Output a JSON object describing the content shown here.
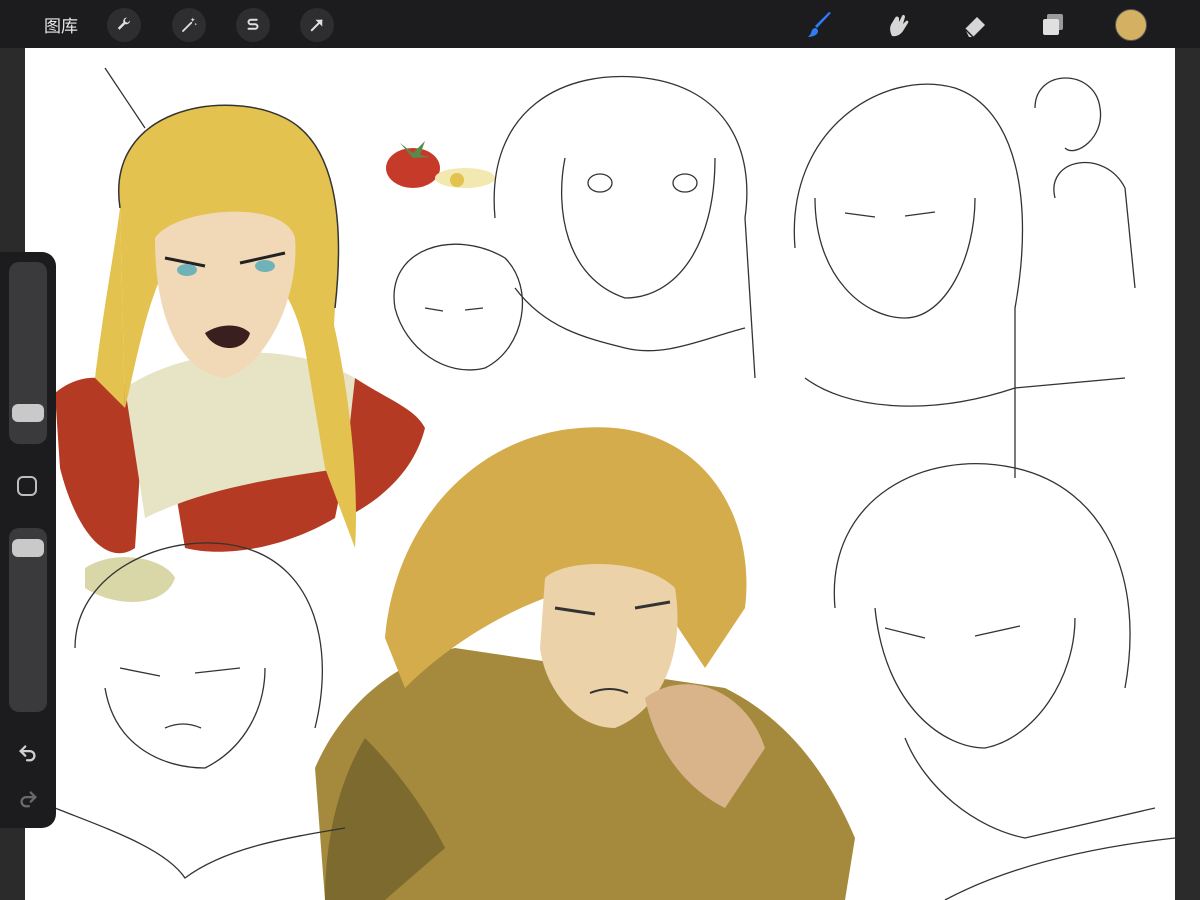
{
  "toolbar": {
    "gallery_label": "图库",
    "left_tools": [
      {
        "name": "actions",
        "icon": "wrench-icon"
      },
      {
        "name": "adjustments",
        "icon": "magic-wand-icon"
      },
      {
        "name": "selection",
        "icon": "selection-s-icon"
      },
      {
        "name": "transform",
        "icon": "arrow-icon"
      }
    ],
    "right_tools": [
      {
        "name": "brush",
        "icon": "brush-icon",
        "active": true
      },
      {
        "name": "smudge",
        "icon": "smudge-icon"
      },
      {
        "name": "eraser",
        "icon": "eraser-icon"
      },
      {
        "name": "layers",
        "icon": "layers-icon"
      }
    ],
    "current_color": "#d4b063",
    "active_color": "#2f7cf6"
  },
  "sidebar": {
    "brush_size_level": 0.12,
    "opacity_level": 0.95
  },
  "canvas": {
    "background": "#ffffff",
    "palette": {
      "blonde": "#e3c24f",
      "scarf_red": "#b53a24",
      "scarf_cream": "#e8e6c8",
      "coat_brown": "#a58a3e",
      "skin": "#f1d9b8",
      "tomato": "#c63a2a"
    }
  }
}
